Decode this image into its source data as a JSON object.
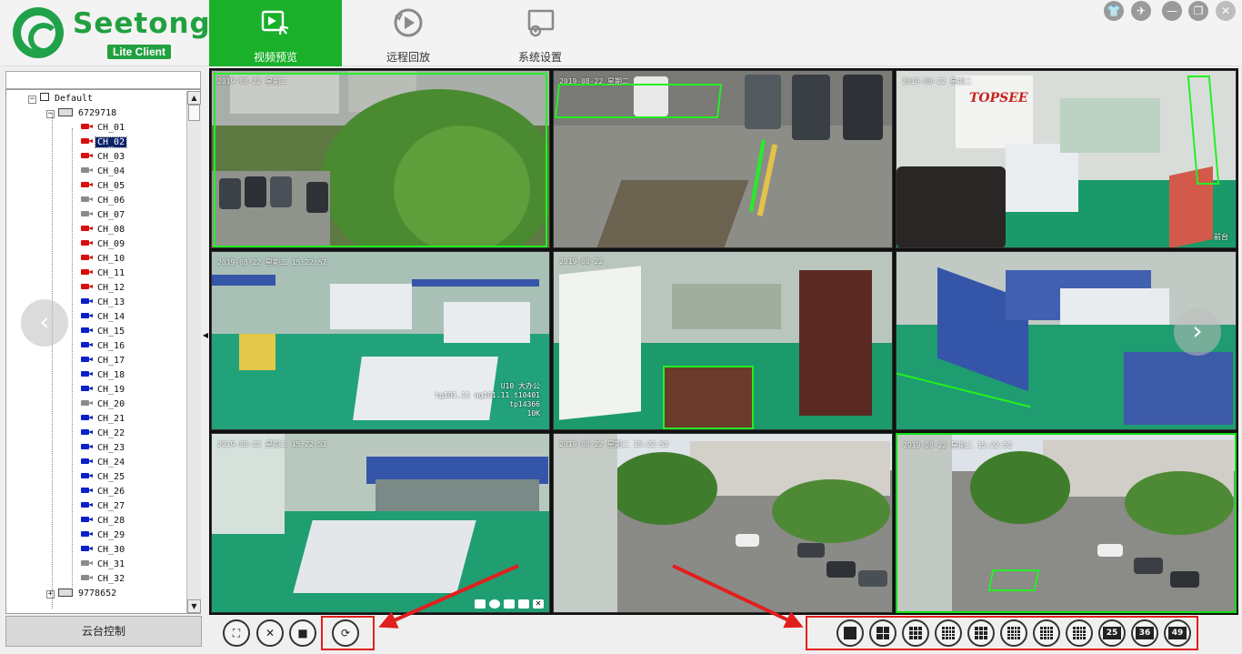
{
  "app": {
    "logo_text": "Seetong",
    "logo_sub": "Lite Client"
  },
  "nav": {
    "tabs": [
      {
        "label": "视频预览",
        "icon": "video-preview-icon",
        "active": true
      },
      {
        "label": "远程回放",
        "icon": "playback-icon",
        "active": false
      },
      {
        "label": "系统设置",
        "icon": "settings-monitor-icon",
        "active": false
      }
    ]
  },
  "window_controls": [
    "skin-icon",
    "pin-icon",
    "minimize-icon",
    "maximize-icon",
    "close-icon"
  ],
  "sidebar": {
    "search_value": "",
    "tree": {
      "root": "Default",
      "devices": [
        {
          "id": "6729718",
          "expanded": true,
          "channels": [
            {
              "label": "CH_01",
              "state": "red"
            },
            {
              "label": "CH_02",
              "state": "red",
              "selected": true
            },
            {
              "label": "CH_03",
              "state": "red"
            },
            {
              "label": "CH_04",
              "state": "gray"
            },
            {
              "label": "CH_05",
              "state": "red"
            },
            {
              "label": "CH_06",
              "state": "gray"
            },
            {
              "label": "CH_07",
              "state": "gray"
            },
            {
              "label": "CH_08",
              "state": "red"
            },
            {
              "label": "CH_09",
              "state": "red"
            },
            {
              "label": "CH_10",
              "state": "red"
            },
            {
              "label": "CH_11",
              "state": "red"
            },
            {
              "label": "CH_12",
              "state": "red"
            },
            {
              "label": "CH_13",
              "state": "blue"
            },
            {
              "label": "CH_14",
              "state": "blue"
            },
            {
              "label": "CH_15",
              "state": "blue"
            },
            {
              "label": "CH_16",
              "state": "blue"
            },
            {
              "label": "CH_17",
              "state": "blue"
            },
            {
              "label": "CH_18",
              "state": "blue"
            },
            {
              "label": "CH_19",
              "state": "blue"
            },
            {
              "label": "CH_20",
              "state": "gray"
            },
            {
              "label": "CH_21",
              "state": "blue"
            },
            {
              "label": "CH_22",
              "state": "blue"
            },
            {
              "label": "CH_23",
              "state": "blue"
            },
            {
              "label": "CH_24",
              "state": "blue"
            },
            {
              "label": "CH_25",
              "state": "blue"
            },
            {
              "label": "CH_26",
              "state": "blue"
            },
            {
              "label": "CH_27",
              "state": "blue"
            },
            {
              "label": "CH_28",
              "state": "blue"
            },
            {
              "label": "CH_29",
              "state": "blue"
            },
            {
              "label": "CH_30",
              "state": "blue"
            },
            {
              "label": "CH_31",
              "state": "gray"
            },
            {
              "label": "CH_32",
              "state": "gray"
            }
          ]
        },
        {
          "id": "9778652",
          "expanded": false,
          "channels": []
        }
      ]
    },
    "ptz_button": "云台控制"
  },
  "tiles": [
    {
      "timestamp": "2019-08-22 星期二",
      "name": "",
      "scene": "courtyard"
    },
    {
      "timestamp": "2019-08-22 星期二",
      "name": "",
      "scene": "parking-top"
    },
    {
      "timestamp": "2019-08-22 星期二",
      "name": "前台",
      "scene": "reception",
      "logo": "TOPSEE"
    },
    {
      "timestamp": "2019-08-22 星期二 15:22:52",
      "name": "10K",
      "scene": "office1"
    },
    {
      "timestamp": "2019-08-22",
      "name": "",
      "scene": "office2"
    },
    {
      "timestamp": "",
      "name": "",
      "scene": "office3"
    },
    {
      "timestamp": "2019-08-22 星期二 15:22:52",
      "name": "",
      "scene": "office4"
    },
    {
      "timestamp": "2019-08-22 星期二 15:22:52",
      "name": "",
      "scene": "parking-wide"
    },
    {
      "timestamp": "2019-08-22 星期二 15:22:52",
      "name": "",
      "scene": "parking-wide2"
    }
  ],
  "tile4_overlay": {
    "line1": "U10  大办公",
    "line2": "tg101.11 ag101.11 t10401",
    "line3": "tp14366"
  },
  "toolbar": {
    "left_buttons": [
      "fullscreen-icon",
      "fit-window-icon",
      "stop-all-icon",
      "cycle-icon"
    ],
    "split_buttons": [
      "1",
      "4",
      "6",
      "8",
      "9",
      "10",
      "13",
      "16",
      "25",
      "36",
      "49"
    ]
  },
  "accent_colors": {
    "active_tab": "#1ab02a",
    "brand": "#22a040",
    "alarm_zone": "#23f023",
    "annotation": "#e0201e"
  }
}
